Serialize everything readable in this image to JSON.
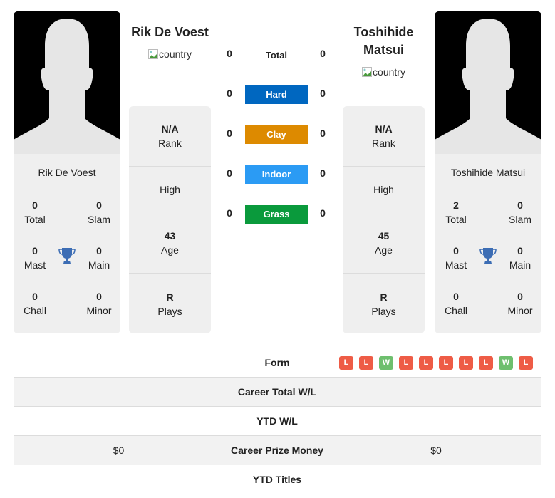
{
  "players": [
    {
      "name": "Rik De Voest",
      "card_name": "Rik De Voest",
      "country_alt": "country",
      "rank": "N/A",
      "rank_label": "Rank",
      "high_label": "High",
      "age": "43",
      "age_label": "Age",
      "plays": "R",
      "plays_label": "Plays",
      "titles": {
        "total": "0",
        "total_label": "Total",
        "slam": "0",
        "slam_label": "Slam",
        "mast": "0",
        "mast_label": "Mast",
        "main": "0",
        "main_label": "Main",
        "chall": "0",
        "chall_label": "Chall",
        "minor": "0",
        "minor_label": "Minor"
      }
    },
    {
      "name": "Toshihide Matsui",
      "name_line1": "Toshihide",
      "name_line2": "Matsui",
      "card_name": "Toshihide Matsui",
      "country_alt": "country",
      "rank": "N/A",
      "rank_label": "Rank",
      "high_label": "High",
      "age": "45",
      "age_label": "Age",
      "plays": "R",
      "plays_label": "Plays",
      "titles": {
        "total": "2",
        "total_label": "Total",
        "slam": "0",
        "slam_label": "Slam",
        "mast": "0",
        "mast_label": "Mast",
        "main": "0",
        "main_label": "Main",
        "chall": "0",
        "chall_label": "Chall",
        "minor": "0",
        "minor_label": "Minor"
      }
    }
  ],
  "h2h": [
    {
      "label": "Total",
      "left": "0",
      "right": "0",
      "color": ""
    },
    {
      "label": "Hard",
      "left": "0",
      "right": "0",
      "color": "#0067c0"
    },
    {
      "label": "Clay",
      "left": "0",
      "right": "0",
      "color": "#dd8a00"
    },
    {
      "label": "Indoor",
      "left": "0",
      "right": "0",
      "color": "#2b9bf4"
    },
    {
      "label": "Grass",
      "left": "0",
      "right": "0",
      "color": "#0a9a3c"
    }
  ],
  "comparison": {
    "form_label": "Form",
    "form": [
      "L",
      "L",
      "W",
      "L",
      "L",
      "L",
      "L",
      "L",
      "W",
      "L"
    ],
    "form_colors": {
      "L": "#ee5c46",
      "W": "#6ebf6e"
    },
    "rows": [
      {
        "label": "Career Total W/L",
        "left": "",
        "right": ""
      },
      {
        "label": "YTD W/L",
        "left": "",
        "right": ""
      },
      {
        "label": "Career Prize Money",
        "left": "$0",
        "right": "$0"
      },
      {
        "label": "YTD Titles",
        "left": "",
        "right": ""
      }
    ]
  },
  "colors": {
    "trophy": "#3c6db4",
    "card_bg": "#efefef"
  }
}
